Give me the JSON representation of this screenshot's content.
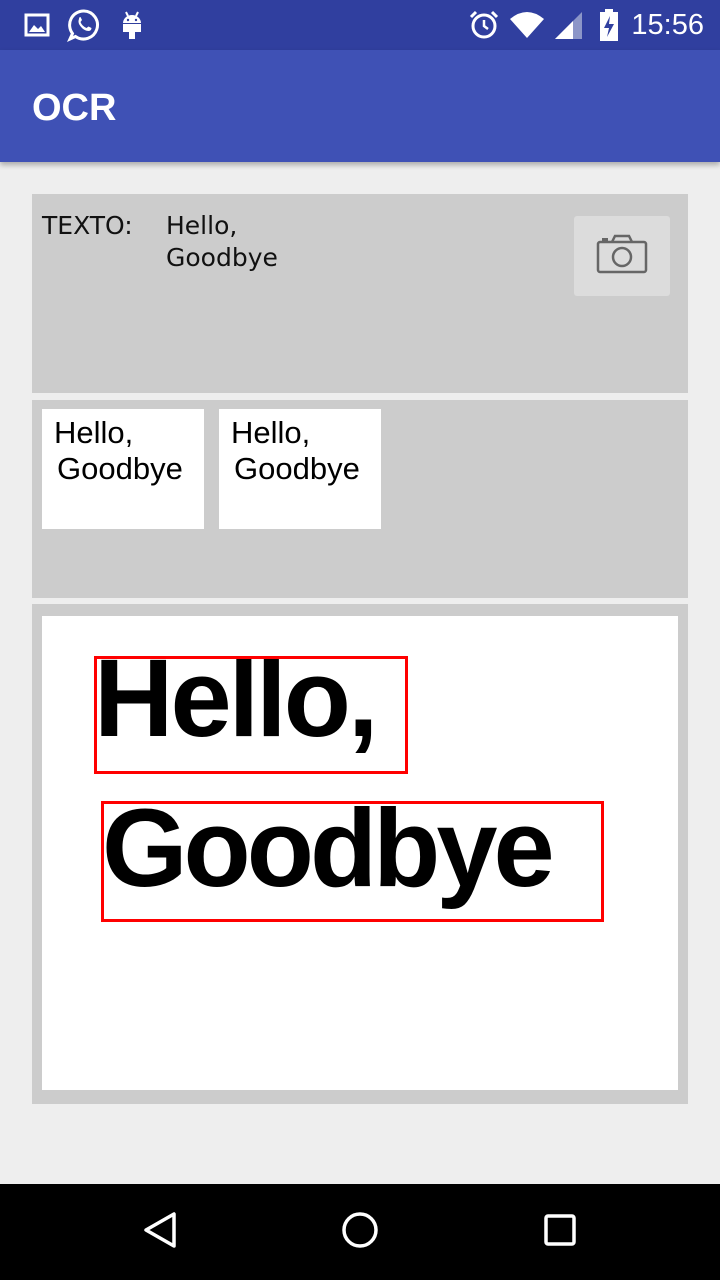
{
  "status_bar": {
    "time": "15:56",
    "icons": [
      "gallery-icon",
      "whatsapp-icon",
      "android-icon",
      "alarm-icon",
      "wifi-icon",
      "signal-icon",
      "battery-charging-icon"
    ]
  },
  "app_bar": {
    "title": "OCR"
  },
  "result": {
    "label": "TEXTO:",
    "lines": [
      "Hello,",
      "Goodbye"
    ],
    "camera_icon": "camera-icon"
  },
  "thumbnails": [
    {
      "lines": [
        "Hello,",
        "Goodbye"
      ]
    },
    {
      "lines": [
        "Hello,",
        "Goodbye"
      ]
    }
  ],
  "image": {
    "words": [
      "Hello,",
      "Goodbye"
    ],
    "box_color": "#ff0000"
  },
  "nav_bar": {
    "icons": [
      "back-icon",
      "home-icon",
      "recents-icon"
    ]
  },
  "colors": {
    "primary": "#3f51b5",
    "primary_dark": "#303f9f",
    "panel": "#cccccc",
    "background": "#eeeeee"
  }
}
